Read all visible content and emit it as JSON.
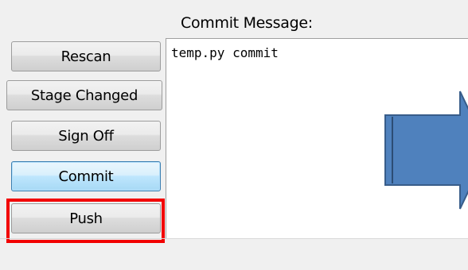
{
  "commit_panel": {
    "label": "Commit Message:",
    "message": "temp.py commit"
  },
  "buttons": {
    "rescan": "Rescan",
    "stage_changed": "Stage Changed",
    "sign_off": "Sign Off",
    "commit": "Commit",
    "push": "Push"
  },
  "colors": {
    "highlight": "#f20000",
    "arrow_fill": "#4f81bd",
    "arrow_stroke": "#385d8a"
  },
  "icons": {
    "annotation_arrow": "right-arrow-icon"
  }
}
